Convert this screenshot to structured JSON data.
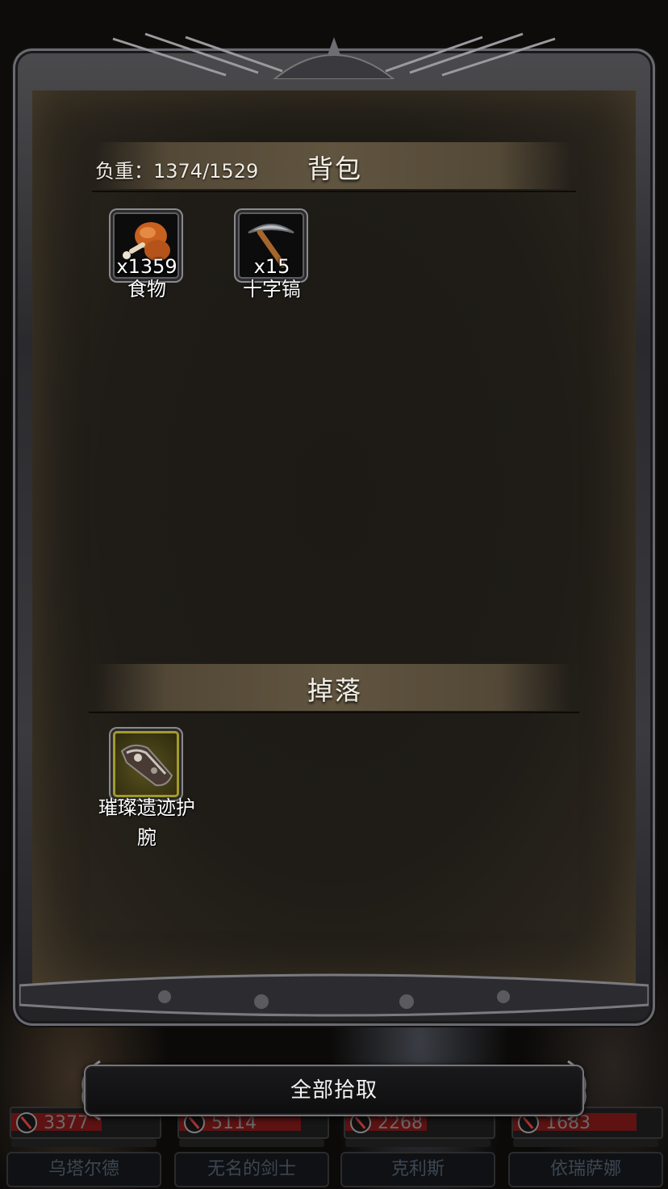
{
  "backpack": {
    "title": "背包",
    "weight_label": "负重：1374/1529",
    "items": [
      {
        "name": "食物",
        "quantity": "x1359",
        "icon": "roasted-meat-icon"
      },
      {
        "name": "十字镐",
        "quantity": "x15",
        "icon": "pickaxe-icon"
      }
    ]
  },
  "drops": {
    "title": "掉落",
    "items": [
      {
        "name_line1": "璀璨遗迹护",
        "name_line2": "腕",
        "icon": "bracer-icon",
        "rarity_color": "#a39a2c"
      }
    ]
  },
  "pick_all_button": "全部拾取",
  "party": [
    {
      "name": "乌塔尔德",
      "hp": "3377",
      "hp_fraction": 0.62
    },
    {
      "name": "无名的剑士",
      "hp": "5114",
      "hp_fraction": 0.84
    },
    {
      "name": "克利斯",
      "hp": "2268",
      "hp_fraction": 0.56
    },
    {
      "name": "依瑞萨娜",
      "hp": "1683",
      "hp_fraction": 0.85
    }
  ],
  "colors": {
    "hp_bar": "#5e1212",
    "panel_bg": "#1f1c17",
    "header_band": "#645842"
  }
}
